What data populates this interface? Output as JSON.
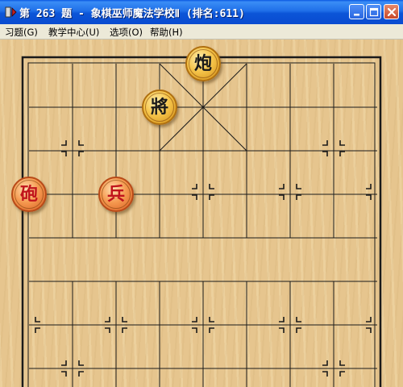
{
  "window": {
    "title": "第 263 题 - 象棋巫师魔法学校Ⅱ (排名:611)",
    "controls": {
      "minimize": "minimize-icon",
      "maximize": "maximize-icon",
      "close": "close-icon"
    }
  },
  "menu": {
    "items": [
      {
        "label": "习题(G)"
      },
      {
        "label": "教学中心(U)"
      },
      {
        "label": "选项(O)"
      },
      {
        "label": "帮助(H)"
      }
    ]
  },
  "board": {
    "colors": {
      "wood": "#e6c58e",
      "line": "#1a1a1a",
      "black_piece": "#f5c44a",
      "red_piece": "#f59a50",
      "red_text": "#c0141c"
    },
    "pieces": [
      {
        "char": "炮",
        "side": "black"
      },
      {
        "char": "將",
        "side": "black"
      },
      {
        "char": "砲",
        "side": "red"
      },
      {
        "char": "兵",
        "side": "red"
      }
    ]
  }
}
